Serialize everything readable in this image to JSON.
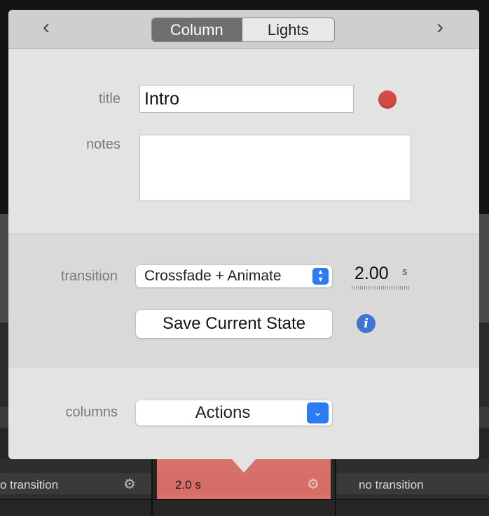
{
  "toolbar": {
    "prev_icon": "chevron-left-icon",
    "next_icon": "chevron-right-icon",
    "tabs": [
      {
        "label": "Column",
        "active": true
      },
      {
        "label": "Lights",
        "active": false
      }
    ]
  },
  "form": {
    "title_label": "title",
    "title_value": "Intro",
    "color_dot": "#d64a45",
    "notes_label": "notes",
    "notes_value": "",
    "transition_label": "transition",
    "transition_value": "Crossfade + Animate",
    "duration_value": "2.00",
    "duration_unit": "s",
    "save_button": "Save Current State",
    "info_icon": "i",
    "columns_label": "columns",
    "columns_value": "Actions"
  },
  "background": {
    "cells": [
      {
        "text": "o transition"
      },
      {
        "text": "2.0  s"
      },
      {
        "text": "no transition"
      }
    ],
    "gear_icon": "✱"
  },
  "colors": {
    "accent": "#2c7bf1",
    "selected_cell": "#d9716b",
    "info": "#3f73d6"
  }
}
